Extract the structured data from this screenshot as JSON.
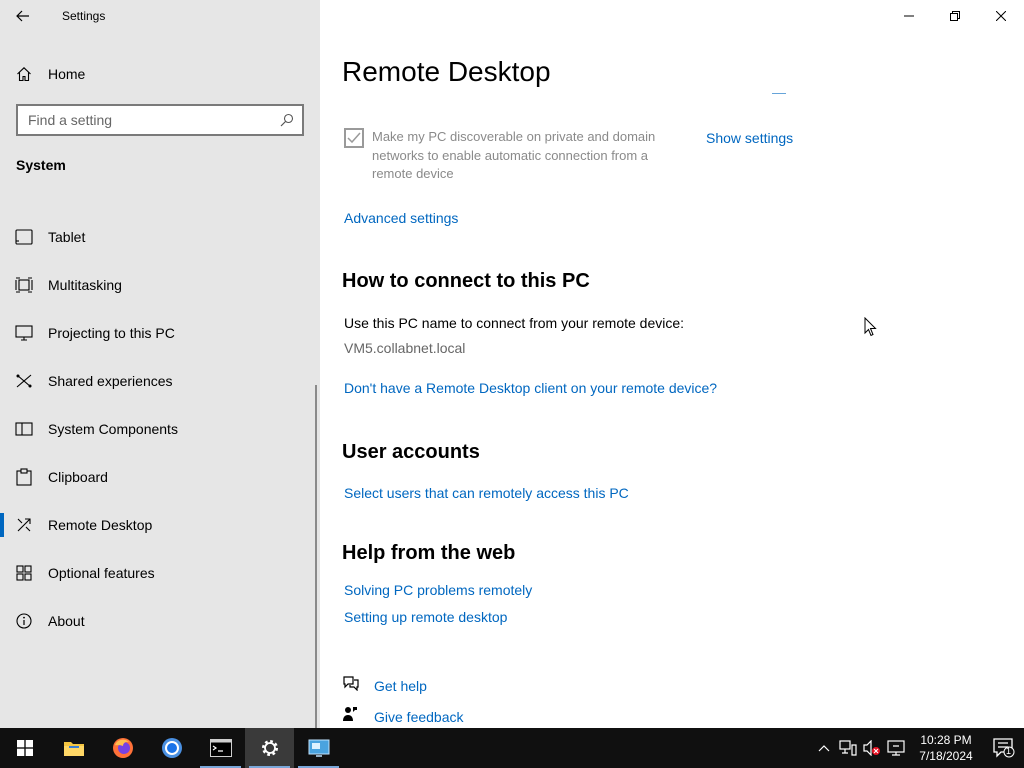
{
  "window": {
    "title": "Settings"
  },
  "sidebar": {
    "home_label": "Home",
    "search_placeholder": "Find a setting",
    "section": "System",
    "items": [
      {
        "label": "Tablet",
        "icon": "tablet-icon"
      },
      {
        "label": "Multitasking",
        "icon": "multitasking-icon"
      },
      {
        "label": "Projecting to this PC",
        "icon": "projecting-icon"
      },
      {
        "label": "Shared experiences",
        "icon": "shared-experiences-icon"
      },
      {
        "label": "System Components",
        "icon": "system-components-icon"
      },
      {
        "label": "Clipboard",
        "icon": "clipboard-icon"
      },
      {
        "label": "Remote Desktop",
        "icon": "remote-desktop-icon",
        "active": true
      },
      {
        "label": "Optional features",
        "icon": "optional-features-icon"
      },
      {
        "label": "About",
        "icon": "info-icon"
      }
    ]
  },
  "main": {
    "title": "Remote Desktop",
    "discoverable_checkbox": {
      "label": "Make my PC discoverable on private and domain networks to enable automatic connection from a remote device",
      "checked": true,
      "enabled": false
    },
    "show_settings_link": "Show settings",
    "advanced_settings_link": "Advanced settings",
    "connect_heading": "How to connect to this PC",
    "connect_desc": "Use this PC name to connect from your remote device:",
    "pc_name": "VM5.collabnet.local",
    "client_link": "Don't have a Remote Desktop client on your remote device?",
    "user_accounts_heading": "User accounts",
    "select_users_link": "Select users that can remotely access this PC",
    "help_heading": "Help from the web",
    "help_links": [
      "Solving PC problems remotely",
      "Setting up remote desktop"
    ],
    "get_help": "Get help",
    "give_feedback": "Give feedback"
  },
  "taskbar": {
    "apps": [
      "file-explorer-icon",
      "firefox-icon",
      "chrome-icon",
      "terminal-icon",
      "settings-icon",
      "remote-desktop-connection-icon"
    ],
    "time": "10:28 PM",
    "date": "7/18/2024",
    "notification_count": "1"
  },
  "colors": {
    "accent": "#0067c0",
    "sidebar_bg": "#e6e6e6",
    "taskbar_bg": "#101010"
  }
}
